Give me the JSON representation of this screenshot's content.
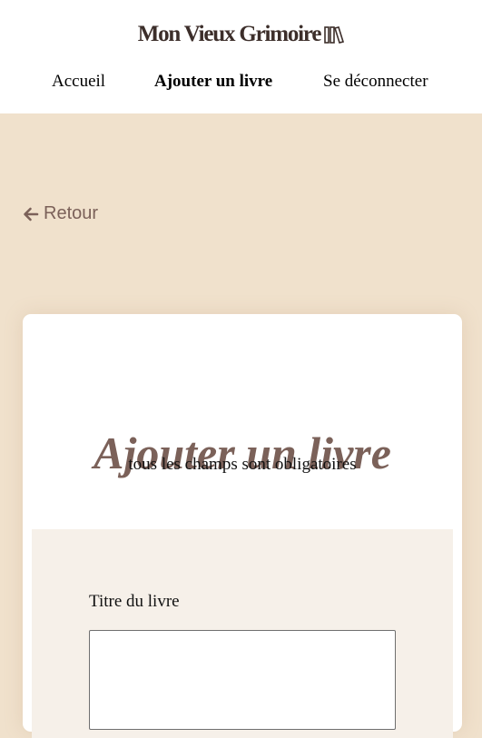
{
  "header": {
    "logo_text": "Mon Vieux Grimoire",
    "logo_icon": "books-icon",
    "nav": [
      {
        "label": "Accueil"
      },
      {
        "label": "Ajouter un livre",
        "active": true
      },
      {
        "label": "Se déconnecter"
      }
    ]
  },
  "back": {
    "label": "Retour",
    "icon": "arrow-left-icon"
  },
  "form": {
    "title": "Ajouter un livre",
    "subtitle": "tous les champs sont obligatoires",
    "fields": [
      {
        "label": "Titre du livre",
        "value": ""
      }
    ]
  },
  "colors": {
    "page_bg": "#f0e1cc",
    "accent": "#7b6159",
    "card_bg": "#ffffff",
    "form_bg": "#f6f0e9"
  }
}
